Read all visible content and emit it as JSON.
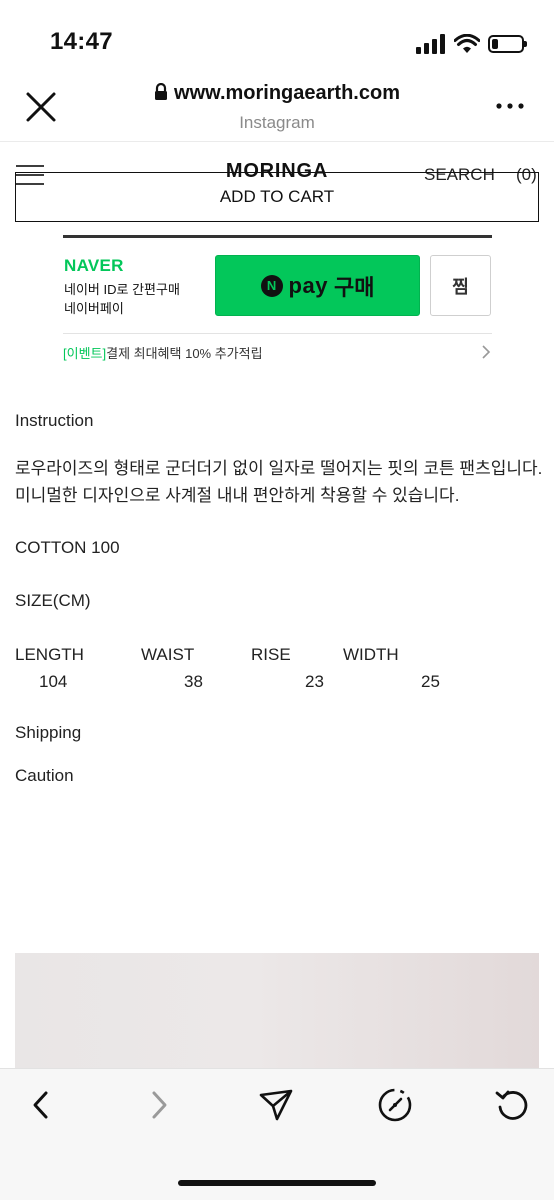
{
  "status_bar": {
    "time": "14:47",
    "icons": [
      "cellular-signal-icon",
      "wifi-icon",
      "battery-icon"
    ],
    "battery_level": 0.22
  },
  "browser": {
    "url": "www.moringaearth.com",
    "source": "Instagram",
    "icons": [
      "close-icon",
      "lock-icon",
      "more-icon"
    ]
  },
  "site_header": {
    "brand": "MORINGA",
    "search_label": "SEARCH",
    "cart_count": "(0)",
    "add_to_cart": "ADD TO CART"
  },
  "naver_pay": {
    "logo": "NAVER",
    "line1": "네이버 ID로 간편구매",
    "line2": "네이버페이",
    "pay_button": {
      "badge": "N",
      "label": "pay",
      "suffix": "구매"
    },
    "zzim_button": "찜",
    "event_tag": "[이벤트]",
    "event_text": "결제 최대혜택 10% 추가적립",
    "colors": {
      "green": "#03c75a"
    }
  },
  "product": {
    "instruction_title": "Instruction",
    "description_line1": "로우라이즈의 형태로 군더더기 없이 일자로 떨어지는 핏의 코튼 팬츠입니다.",
    "description_line2": "미니멀한 디자인으로 사계절 내내 편안하게 착용할 수 있습니다.",
    "material": "COTTON 100",
    "size_title": "SIZE(CM)",
    "size_table": {
      "headers": [
        "LENGTH",
        "WAIST",
        "RISE",
        "WIDTH"
      ],
      "values": [
        "104",
        "38",
        "23",
        "25"
      ]
    },
    "shipping": "Shipping",
    "caution": "Caution"
  },
  "toolbar": {
    "buttons": [
      "back-icon",
      "forward-icon",
      "share-icon",
      "compass-icon",
      "reload-icon"
    ]
  }
}
